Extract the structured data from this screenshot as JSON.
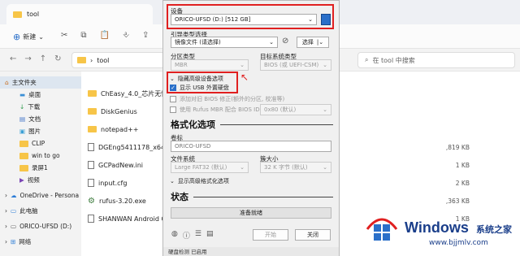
{
  "explorer": {
    "tab_title": "tool",
    "toolbar": {
      "new_label": "新建"
    },
    "address": {
      "path": "tool"
    },
    "search": {
      "placeholder": "在 tool 中搜索"
    },
    "nav": [
      {
        "label": "主文件夹",
        "selected": true
      },
      {
        "label": "桌面"
      },
      {
        "label": "下载"
      },
      {
        "label": "文档"
      },
      {
        "label": "图片"
      },
      {
        "label": "CLIP"
      },
      {
        "label": "win to go"
      },
      {
        "label": "录屏1"
      },
      {
        "label": "视频"
      },
      {
        "label": "OneDrive - Persona"
      },
      {
        "label": "此电脑"
      },
      {
        "label": "ORICO-UFSD (D:)"
      },
      {
        "label": "网络"
      }
    ],
    "files": [
      {
        "name": "ChEasy_4.0_芯片无忧 (E",
        "type": "folder",
        "size": ""
      },
      {
        "name": "DiskGenius",
        "type": "folder",
        "size": ""
      },
      {
        "name": "notepad++",
        "type": "folder",
        "size": ""
      },
      {
        "name": "DGEng5411178_x64.zip",
        "type": "file",
        "size": ",819 KB"
      },
      {
        "name": "GCPadNew.ini",
        "type": "file",
        "size": "1 KB"
      },
      {
        "name": "input.cfg",
        "type": "file",
        "size": "2 KB"
      },
      {
        "name": "rufus-3.20.exe",
        "type": "file",
        "size": ",363 KB"
      },
      {
        "name": "SHANWAN Android Gam",
        "type": "file",
        "size": "1 KB"
      }
    ]
  },
  "rufus": {
    "device_label": "设备",
    "device_value": "ORICO-UFSD (D:) [512 GB]",
    "boot_label": "引导类型选择",
    "boot_value": "镜像文件 (请选择)",
    "select_button": "选择",
    "partition_label": "分区类型",
    "partition_value": "MBR",
    "target_label": "目标系统类型",
    "target_value": "BIOS (或 UEFI-CSM)",
    "hide_advanced": "隐藏高级设备选项",
    "show_usb": "显示 USB 外置硬盘",
    "add_fix": "添加对旧 BIOS 修正(额外的分区, 校准等)",
    "use_rufus_mbr": "使用 Rufus MBR 配合 BIOS ID",
    "bios_id_value": "0x80 (默认)",
    "format_section": "格式化选项",
    "volume_label": "卷标",
    "volume_value": "ORICO-UFSD",
    "fs_label": "文件系统",
    "fs_value": "Large FAT32 (默认)",
    "cluster_label": "簇大小",
    "cluster_value": "32 K 字节 (默认)",
    "show_format_adv": "显示高级格式化选项",
    "status_section": "状态",
    "status_text": "准备就绪",
    "start_button": "开始",
    "close_button": "关闭",
    "bottom_text": "硬盘检测 已启用"
  },
  "watermark": {
    "brand": "Windows",
    "brand_cn": "系统之家",
    "url": "www.bjjmlv.com"
  },
  "colors": {
    "accent": "#2a6fc9",
    "highlight_red": "#e02020",
    "folder": "#f7c548"
  }
}
